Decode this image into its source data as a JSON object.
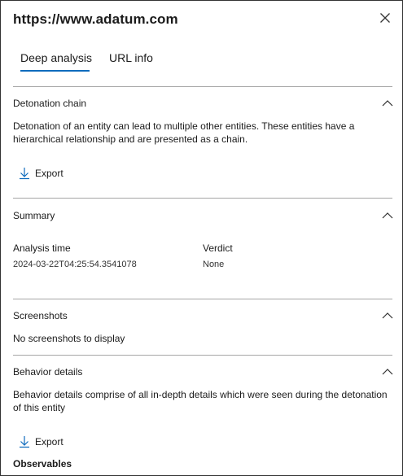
{
  "header": {
    "title": "https://www.adatum.com",
    "close_icon": "close-icon"
  },
  "tabs": [
    {
      "label": "Deep analysis",
      "selected": true
    },
    {
      "label": "URL info",
      "selected": false
    }
  ],
  "accent_color": "#0f6cbd",
  "sections": {
    "detonation": {
      "title": "Detonation chain",
      "description": "Detonation of an entity can lead to multiple other entities. These entities have a hierarchical relationship and are presented as a chain.",
      "export_label": "Export"
    },
    "summary": {
      "title": "Summary",
      "analysis_time_label": "Analysis time",
      "analysis_time_value": "2024-03-22T04:25:54.3541078",
      "verdict_label": "Verdict",
      "verdict_value": "None"
    },
    "screenshots": {
      "title": "Screenshots",
      "empty_text": "No screenshots to display"
    },
    "behavior": {
      "title": "Behavior details",
      "description": "Behavior details comprise of all in-depth details which were seen during the detonation of this entity",
      "export_label": "Export",
      "observables_label": "Observables"
    }
  }
}
